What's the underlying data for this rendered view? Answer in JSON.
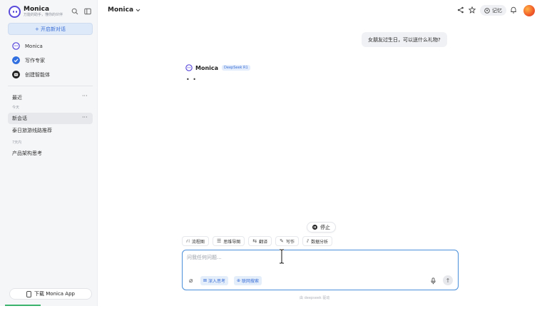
{
  "sidebar": {
    "brand_name": "Monica",
    "brand_slogan": "万能的助手，懂你的伙伴",
    "new_chat_label": "+ 开启新对话",
    "nav": [
      {
        "label": "Monica",
        "icon": "monica-icon"
      },
      {
        "label": "写作专家",
        "icon": "pen-check-icon"
      },
      {
        "label": "创建智能体",
        "icon": "robot-icon"
      }
    ],
    "recent_title": "最近",
    "groups": [
      {
        "label": "今天",
        "items": [
          "新会话",
          "泰日旅游线路推荐"
        ]
      },
      {
        "label": "7天内",
        "items": [
          "产品架构思考"
        ]
      }
    ],
    "download_label": "下载 Monica App"
  },
  "header": {
    "model_name": "Monica",
    "memory_label": "记忆"
  },
  "chat": {
    "user_message": "女朋友过生日，可以送什么礼物?",
    "bot_name": "Monica",
    "model_badge": "DeepSeek R1",
    "typing": "• •"
  },
  "composer": {
    "stop_label": "停止",
    "tools": [
      {
        "label": "流程图",
        "icon": "flowchart-icon",
        "glyph": "⛙"
      },
      {
        "label": "思维导图",
        "icon": "mindmap-icon",
        "glyph": "☰"
      },
      {
        "label": "翻译",
        "icon": "translate-icon",
        "glyph": "⇆"
      },
      {
        "label": "写作",
        "icon": "write-icon",
        "glyph": "✎"
      },
      {
        "label": "数据分析",
        "icon": "chart-icon",
        "glyph": "⫽"
      }
    ],
    "placeholder": "问我任何问题...",
    "deep_think_label": "深入思考",
    "web_search_label": "联网搜索",
    "footer_note": "由 deepseek 驱动"
  },
  "colors": {
    "accent": "#3b6fd6",
    "brand": "#5b4bdb",
    "input_border": "#4a8fd9"
  }
}
